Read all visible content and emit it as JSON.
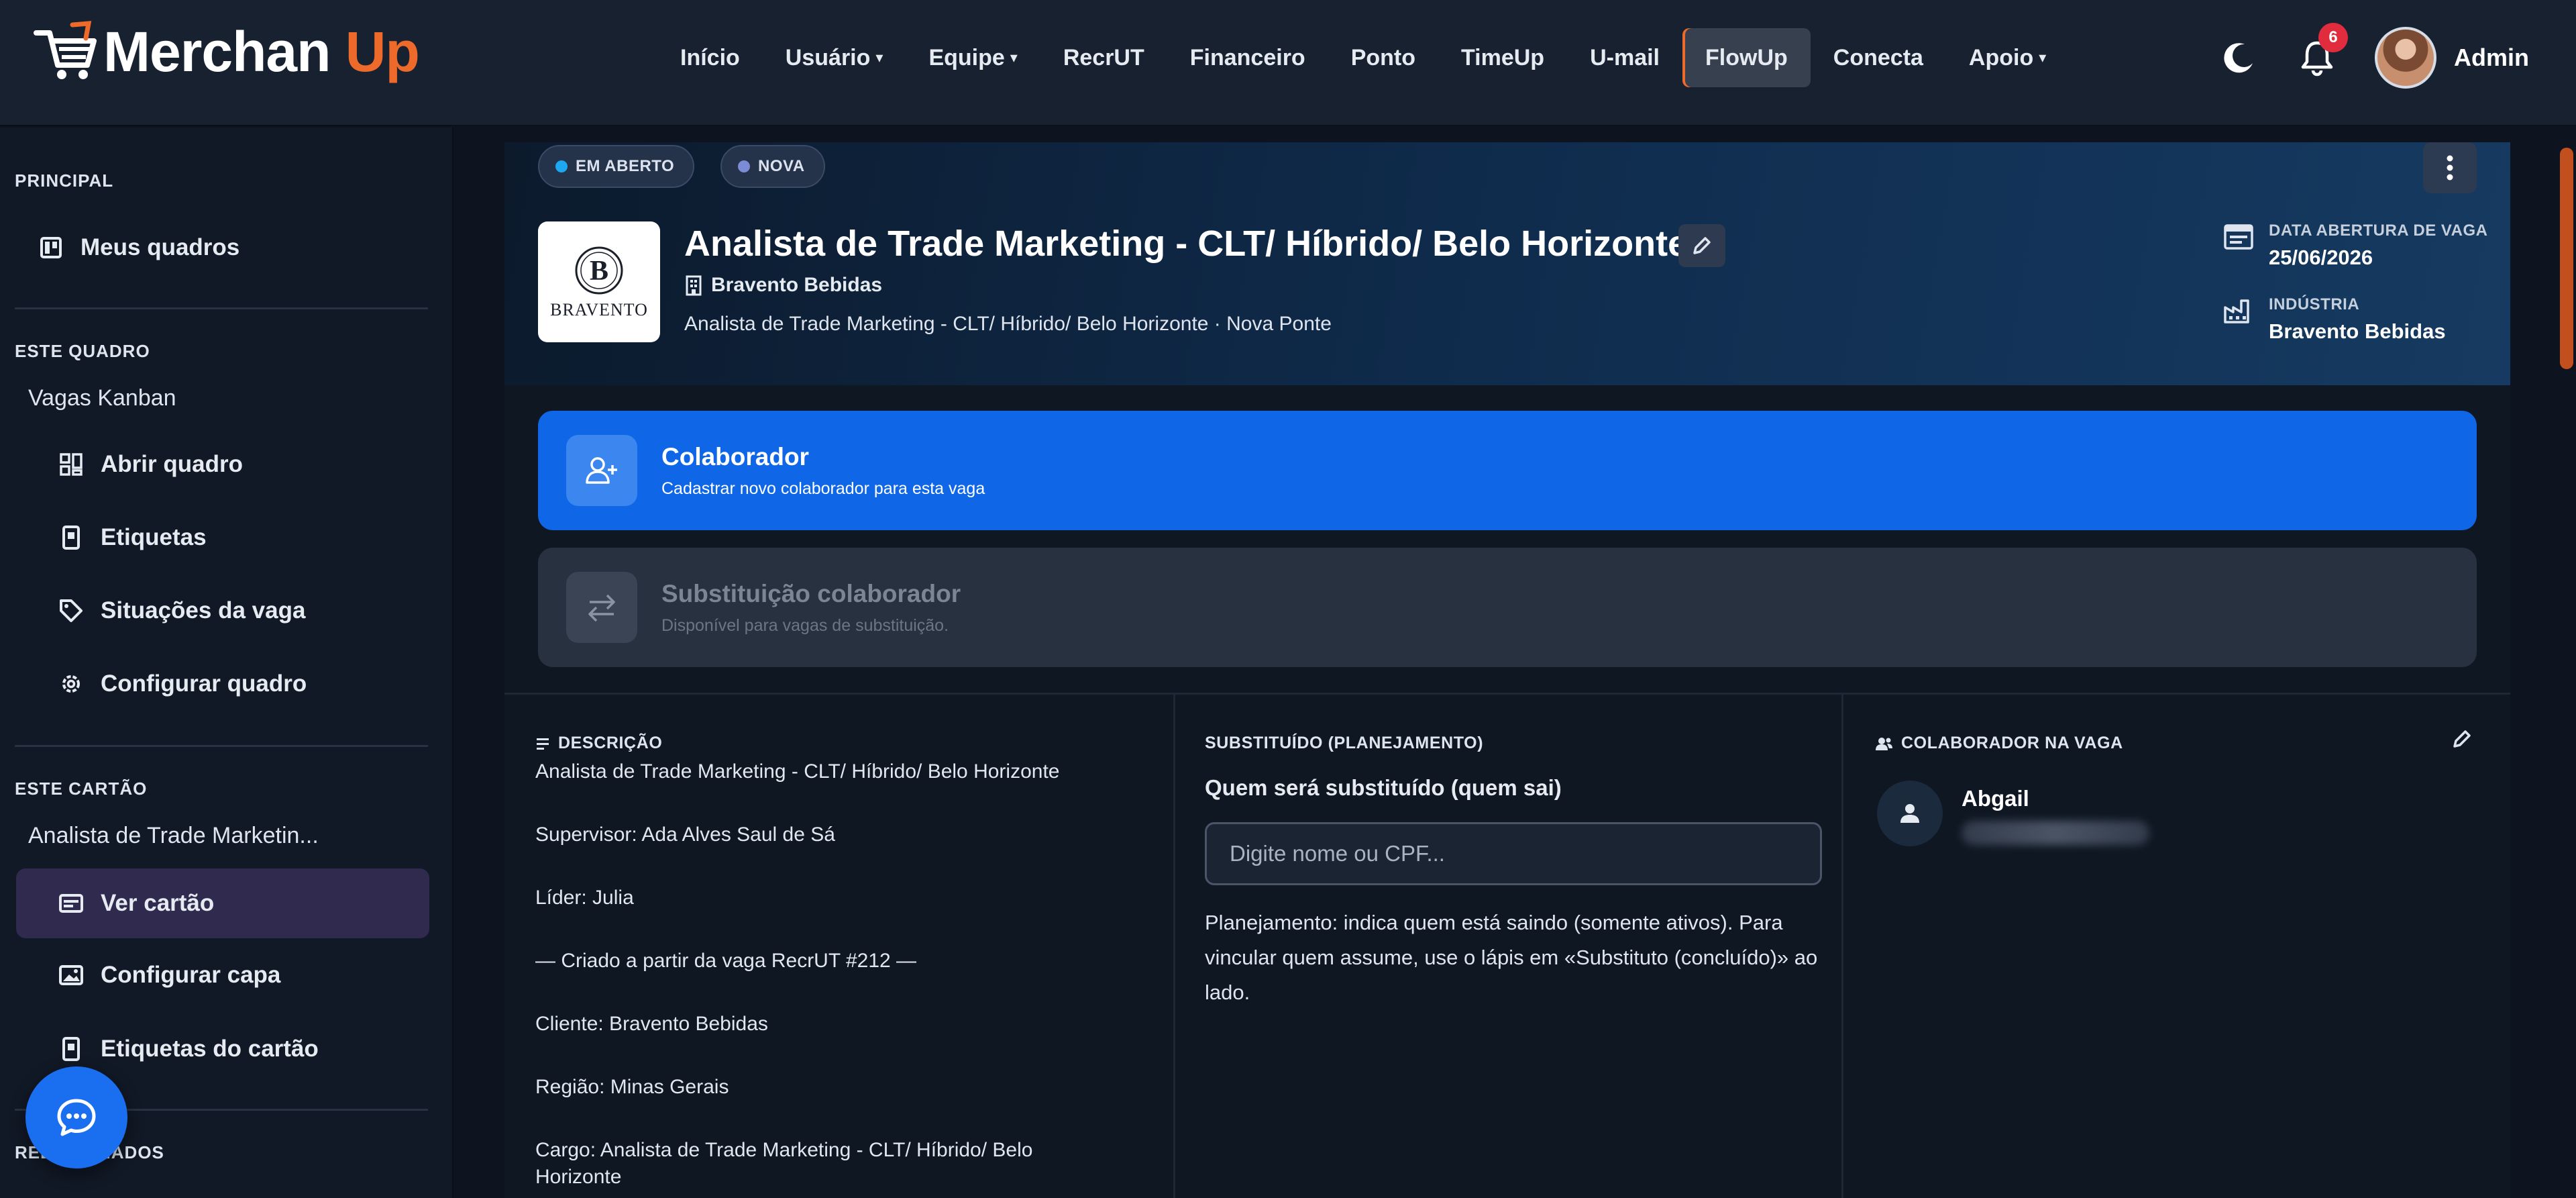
{
  "brand": {
    "name_part1": "Merchan",
    "name_part2": "Up",
    "accent": "#ee6a2a"
  },
  "nav": {
    "items": [
      {
        "label": "Início",
        "dropdown": false
      },
      {
        "label": "Usuário",
        "dropdown": true
      },
      {
        "label": "Equipe",
        "dropdown": true
      },
      {
        "label": "RecrUT",
        "dropdown": false
      },
      {
        "label": "Financeiro",
        "dropdown": false
      },
      {
        "label": "Ponto",
        "dropdown": false
      },
      {
        "label": "TimeUp",
        "dropdown": false
      },
      {
        "label": "U-mail",
        "dropdown": false
      },
      {
        "label": "FlowUp",
        "dropdown": false,
        "active": true
      },
      {
        "label": "Conecta",
        "dropdown": false
      },
      {
        "label": "Apoio",
        "dropdown": true
      }
    ],
    "notifications_count": "6",
    "user_name": "Admin",
    "icons": [
      "moon-icon",
      "bell-icon"
    ]
  },
  "sidebar": {
    "principal_title": "PRINCIPAL",
    "principal_items": [
      {
        "label": "Meus quadros",
        "icon": "board-icon"
      }
    ],
    "board_title": "ESTE QUADRO",
    "board_name": "Vagas Kanban",
    "board_items": [
      {
        "label": "Abrir quadro",
        "icon": "grid-icon"
      },
      {
        "label": "Etiquetas",
        "icon": "tag-card-icon"
      },
      {
        "label": "Situações da vaga",
        "icon": "tag-icon"
      },
      {
        "label": "Configurar quadro",
        "icon": "gear-icon"
      }
    ],
    "card_title": "ESTE CARTÃO",
    "card_name": "Analista de Trade Marketin...",
    "card_items": [
      {
        "label": "Ver cartão",
        "icon": "card-icon",
        "selected": true
      },
      {
        "label": "Configurar capa",
        "icon": "image-icon"
      },
      {
        "label": "Etiquetas do cartão",
        "icon": "tag-card-icon"
      }
    ],
    "related_title": "RELACIONADOS"
  },
  "card": {
    "status_pills": [
      {
        "label": "EM ABERTO",
        "color": "#1ea7f0"
      },
      {
        "label": "NOVA",
        "color": "#7b8bd4"
      }
    ],
    "logo_text": "BRAVENTO",
    "title": "Analista de Trade Marketing - CLT/ Híbrido/ Belo Horizonte",
    "company": "Bravento Bebidas",
    "subline": "Analista de Trade Marketing - CLT/ Híbrido/ Belo Horizonte · Nova Ponte",
    "meta": [
      {
        "label": "DATA ABERTURA DE VAGA",
        "value": "25/06/2026",
        "icon": "calendar-icon"
      },
      {
        "label": "INDÚSTRIA",
        "value": "Bravento Bebidas",
        "icon": "industry-icon"
      }
    ],
    "actions": [
      {
        "title": "Colaborador",
        "subtitle": "Cadastrar novo colaborador para esta vaga",
        "enabled": true
      },
      {
        "title": "Substituição colaborador",
        "subtitle": "Disponível para vagas de substituição.",
        "enabled": false
      }
    ],
    "description": {
      "title": "DESCRIÇÃO",
      "lines": [
        "Analista de Trade Marketing - CLT/ Híbrido/ Belo Horizonte",
        "Supervisor: Ada Alves Saul de Sá",
        "Líder: Julia",
        "— Criado a partir da vaga RecrUT #212 —",
        "Cliente: Bravento Bebidas",
        "Região: Minas Gerais",
        "Cargo: Analista de Trade Marketing - CLT/ Híbrido/ Belo",
        "Horizonte"
      ]
    },
    "substituido": {
      "title": "SUBSTITUÍDO (PLANEJAMENTO)",
      "question": "Quem será substituído (quem sai)",
      "placeholder": "Digite nome ou CPF...",
      "help": "Planejamento: indica quem está saindo (somente ativos). Para vincular quem assume, use o lápis em «Substituto (concluído)» ao lado."
    },
    "colaborador": {
      "title": "COLABORADOR NA VAGA",
      "name": "Abgail"
    }
  }
}
